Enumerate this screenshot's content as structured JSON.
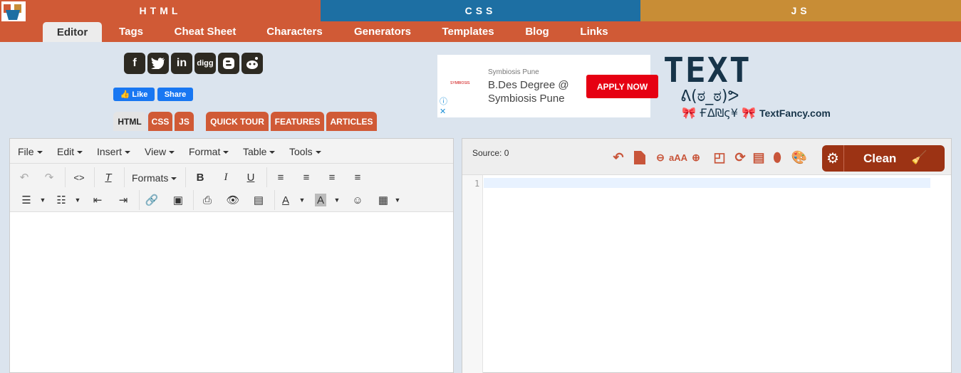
{
  "langbar": {
    "html": "HTML",
    "css": "CSS",
    "js": "JS"
  },
  "nav": {
    "items": [
      "Editor",
      "Tags",
      "Cheat Sheet",
      "Characters",
      "Generators",
      "Templates",
      "Blog",
      "Links"
    ]
  },
  "social": {
    "icons": [
      "facebook-icon",
      "twitter-icon",
      "linkedin-icon",
      "digg-icon",
      "blogger-icon",
      "reddit-icon"
    ],
    "digg_text": "digg"
  },
  "facebook": {
    "like": "Like",
    "share": "Share"
  },
  "subtabs": [
    "HTML",
    "CSS",
    "JS",
    "QUICK TOUR",
    "FEATURES",
    "ARTICLES"
  ],
  "ad": {
    "advertiser": "Symbiosis Pune",
    "headline": "B.Des Degree @ Symbiosis Pune",
    "cta": "APPLY NOW",
    "logo_text": "SYMBIOSIS"
  },
  "textfancy": {
    "big": "TEXT",
    "face": "ᕕ(ಠ_ಠ)ᕗ",
    "fancy": "ҒΔ₪ς¥",
    "site": "TextFancy.com"
  },
  "editor": {
    "menu": [
      "File",
      "Edit",
      "Insert",
      "View",
      "Format",
      "Table",
      "Tools"
    ],
    "formats_label": "Formats"
  },
  "code": {
    "source_label": "Source: 0",
    "clean_label": "Clean",
    "line_number": "1"
  },
  "colors": {
    "html": "#d05a36",
    "css": "#1d6fa3",
    "js": "#c88d36",
    "clean": "#9c3314"
  }
}
